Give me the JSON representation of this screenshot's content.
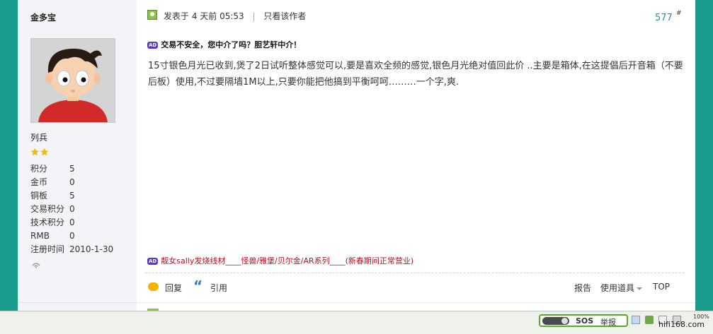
{
  "author": {
    "name": "金多宝",
    "rank": "列兵",
    "stars": "★★",
    "stats": [
      {
        "label": "积分",
        "value": "5"
      },
      {
        "label": "金币",
        "value": "0"
      },
      {
        "label": "铜板",
        "value": "5"
      },
      {
        "label": "交易积分",
        "value": "0"
      },
      {
        "label": "技术积分",
        "value": "0"
      },
      {
        "label": "RMB",
        "value": "0"
      },
      {
        "label": "注册时间",
        "value": "2010-1-30"
      }
    ]
  },
  "post": {
    "posted_label": "发表于",
    "posted_time": "4 天前 05:53",
    "separator": "|",
    "author_only": "只看该作者",
    "floor": "577",
    "floor_mark": "#",
    "ad_badge": "AD",
    "ad_top": "交易不安全，您中介了吗？胆艺轩中介！",
    "body": "15寸银色月光已收到,煲了2日试听整体感觉可以,要是喜欢全频的感觉,银色月光绝对值回此价 ..主要是箱体,在这提倡后开音箱（不要后板）使用,不过要隔墙1M以上,只要你能把他搞到平衡呵呵………一个字,爽.",
    "ad_bottom": "靓女sally发烧线材____怪兽/雅堡/贝尔金/AR系列____(新春期间正常营业)"
  },
  "actions": {
    "reply": "回复",
    "quote": "引用",
    "quote_glyph": "“",
    "report": "报告",
    "tools": "使用道具",
    "top": "TOP"
  },
  "taskbar": {
    "sos": "SOS",
    "report": "举报",
    "site": "hifi168.com",
    "corner": "100%"
  },
  "colors": {
    "frame_teal": "#1a9a8a",
    "sidebar_bg": "#f2f4f7",
    "floor_link": "#2a8fa0",
    "ad_red": "#b01020",
    "ad_badge": "#5a3bb8"
  }
}
